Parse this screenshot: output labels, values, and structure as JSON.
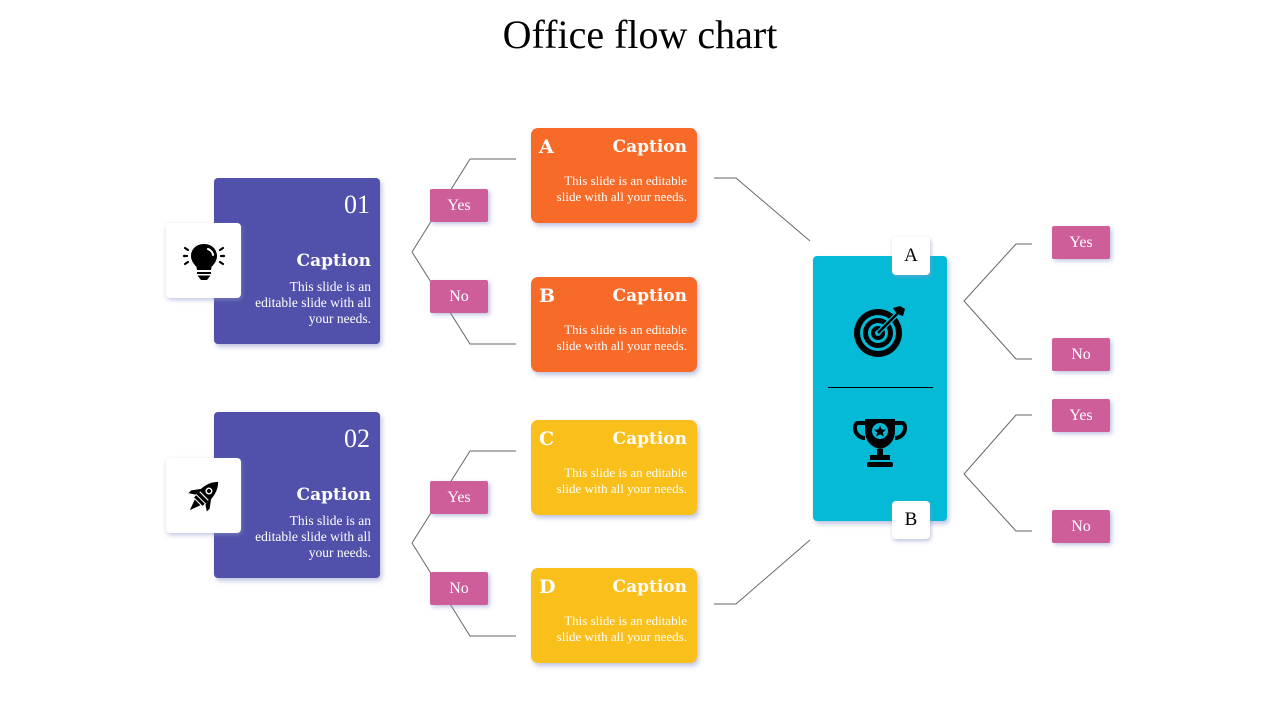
{
  "title": "Office flow chart",
  "colors": {
    "step_card": "#5150aa",
    "option_orange": "#f76a27",
    "option_yellow": "#f9bf1a",
    "decision_pill": "#cd5e9a",
    "goal_panel": "#04bad6"
  },
  "steps": [
    {
      "number": "01",
      "icon": "lightbulb-icon",
      "caption": "Caption",
      "description": "This slide is an editable slide with all your needs.",
      "branches": [
        {
          "decision": "Yes",
          "option": {
            "letter": "A",
            "caption": "Caption",
            "description": "This slide is an editable slide with all your needs."
          }
        },
        {
          "decision": "No",
          "option": {
            "letter": "B",
            "caption": "Caption",
            "description": "This slide is an editable slide with all your needs."
          }
        }
      ]
    },
    {
      "number": "02",
      "icon": "rocket-icon",
      "caption": "Caption",
      "description": "This slide is an editable slide with all your needs.",
      "branches": [
        {
          "decision": "Yes",
          "option": {
            "letter": "C",
            "caption": "Caption",
            "description": "This slide is an editable slide with all your needs."
          }
        },
        {
          "decision": "No",
          "option": {
            "letter": "D",
            "caption": "Caption",
            "description": "This slide is an editable slide with all your needs."
          }
        }
      ]
    }
  ],
  "goal": {
    "top_label": "A",
    "bottom_label": "B",
    "top_icon": "target-icon",
    "bottom_icon": "trophy-icon",
    "outcomes": [
      {
        "label": "A",
        "decisions": [
          "Yes",
          "No"
        ]
      },
      {
        "label": "B",
        "decisions": [
          "Yes",
          "No"
        ]
      }
    ]
  }
}
